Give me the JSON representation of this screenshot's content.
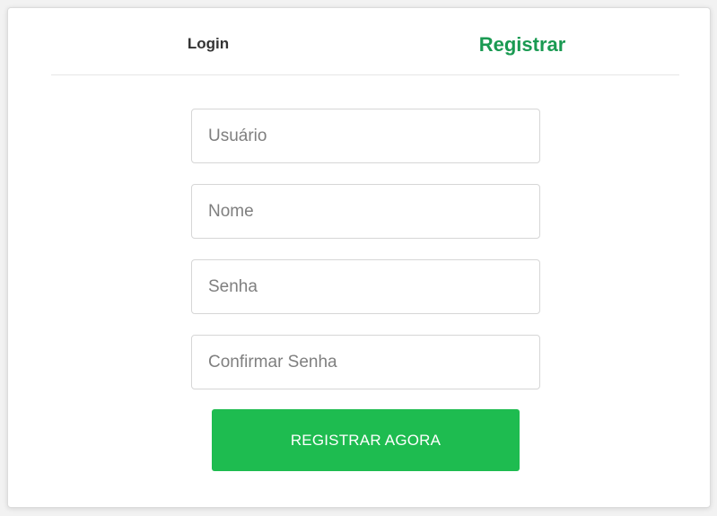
{
  "tabs": {
    "login_label": "Login",
    "register_label": "Registrar",
    "active": "Registrar"
  },
  "form": {
    "username_placeholder": "Usuário",
    "name_placeholder": "Nome",
    "password_placeholder": "Senha",
    "confirm_password_placeholder": "Confirmar Senha",
    "submit_label": "REGISTRAR AGORA"
  },
  "colors": {
    "accent": "#1a9a52",
    "button": "#1ebc50"
  }
}
